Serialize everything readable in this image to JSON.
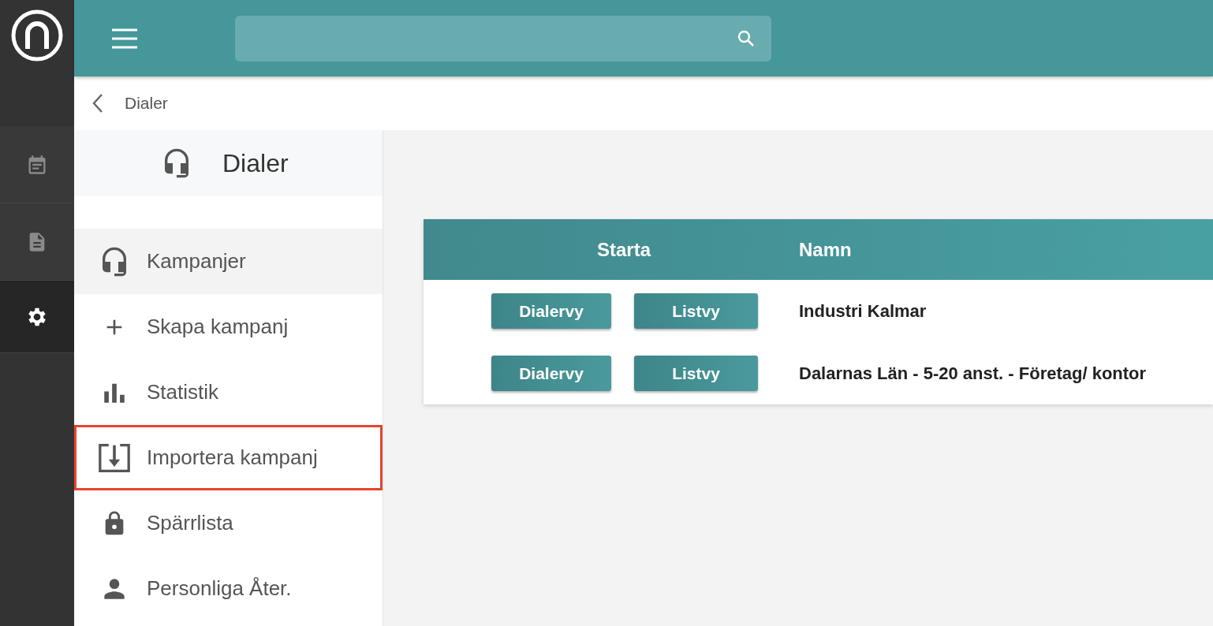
{
  "rail": {
    "items": [
      {
        "selected": false
      },
      {
        "selected": false
      },
      {
        "selected": true
      }
    ]
  },
  "breadcrumb": {
    "label": "Dialer"
  },
  "sidebar": {
    "title": "Dialer",
    "items": [
      {
        "label": "Kampanjer",
        "selected": true,
        "outlined": false
      },
      {
        "label": "Skapa kampanj",
        "selected": false,
        "outlined": false
      },
      {
        "label": "Statistik",
        "selected": false,
        "outlined": false
      },
      {
        "label": "Importera kampanj",
        "selected": false,
        "outlined": true
      },
      {
        "label": "Spärrlista",
        "selected": false,
        "outlined": false
      },
      {
        "label": "Personliga Åter.",
        "selected": false,
        "outlined": false
      }
    ]
  },
  "table": {
    "columns": [
      "Starta",
      "Namn"
    ],
    "rows": [
      {
        "buttons": [
          "Dialervy",
          "Listvy"
        ],
        "name": "Industri Kalmar"
      },
      {
        "buttons": [
          "Dialervy",
          "Listvy"
        ],
        "name": "Dalarnas Län - 5-20 anst. - Företag/ kontor"
      }
    ]
  }
}
